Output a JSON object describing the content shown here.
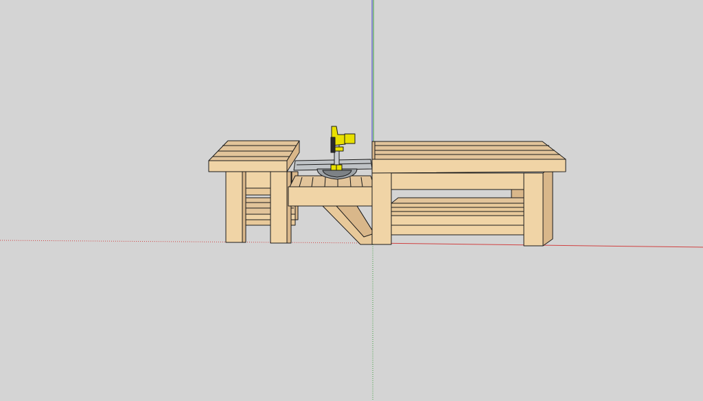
{
  "app": {
    "view": "sketchup-3d-viewport"
  },
  "colors": {
    "background": "#d4d4d4",
    "wood_top": "#e2c49a",
    "wood_front": "#f0d4a6",
    "wood_side": "#d9b78a",
    "wood_dark": "#c9a474",
    "edge": "#1a1a1a",
    "axis_red": "#d04040",
    "axis_green": "#3ca03c",
    "axis_blue": "#4040d0",
    "saw_yellow": "#e8e000",
    "saw_metal": "#bfc3c6"
  },
  "model": {
    "objects": [
      "left-workbench",
      "miter-saw-platform",
      "miter-saw",
      "right-workbench"
    ]
  }
}
